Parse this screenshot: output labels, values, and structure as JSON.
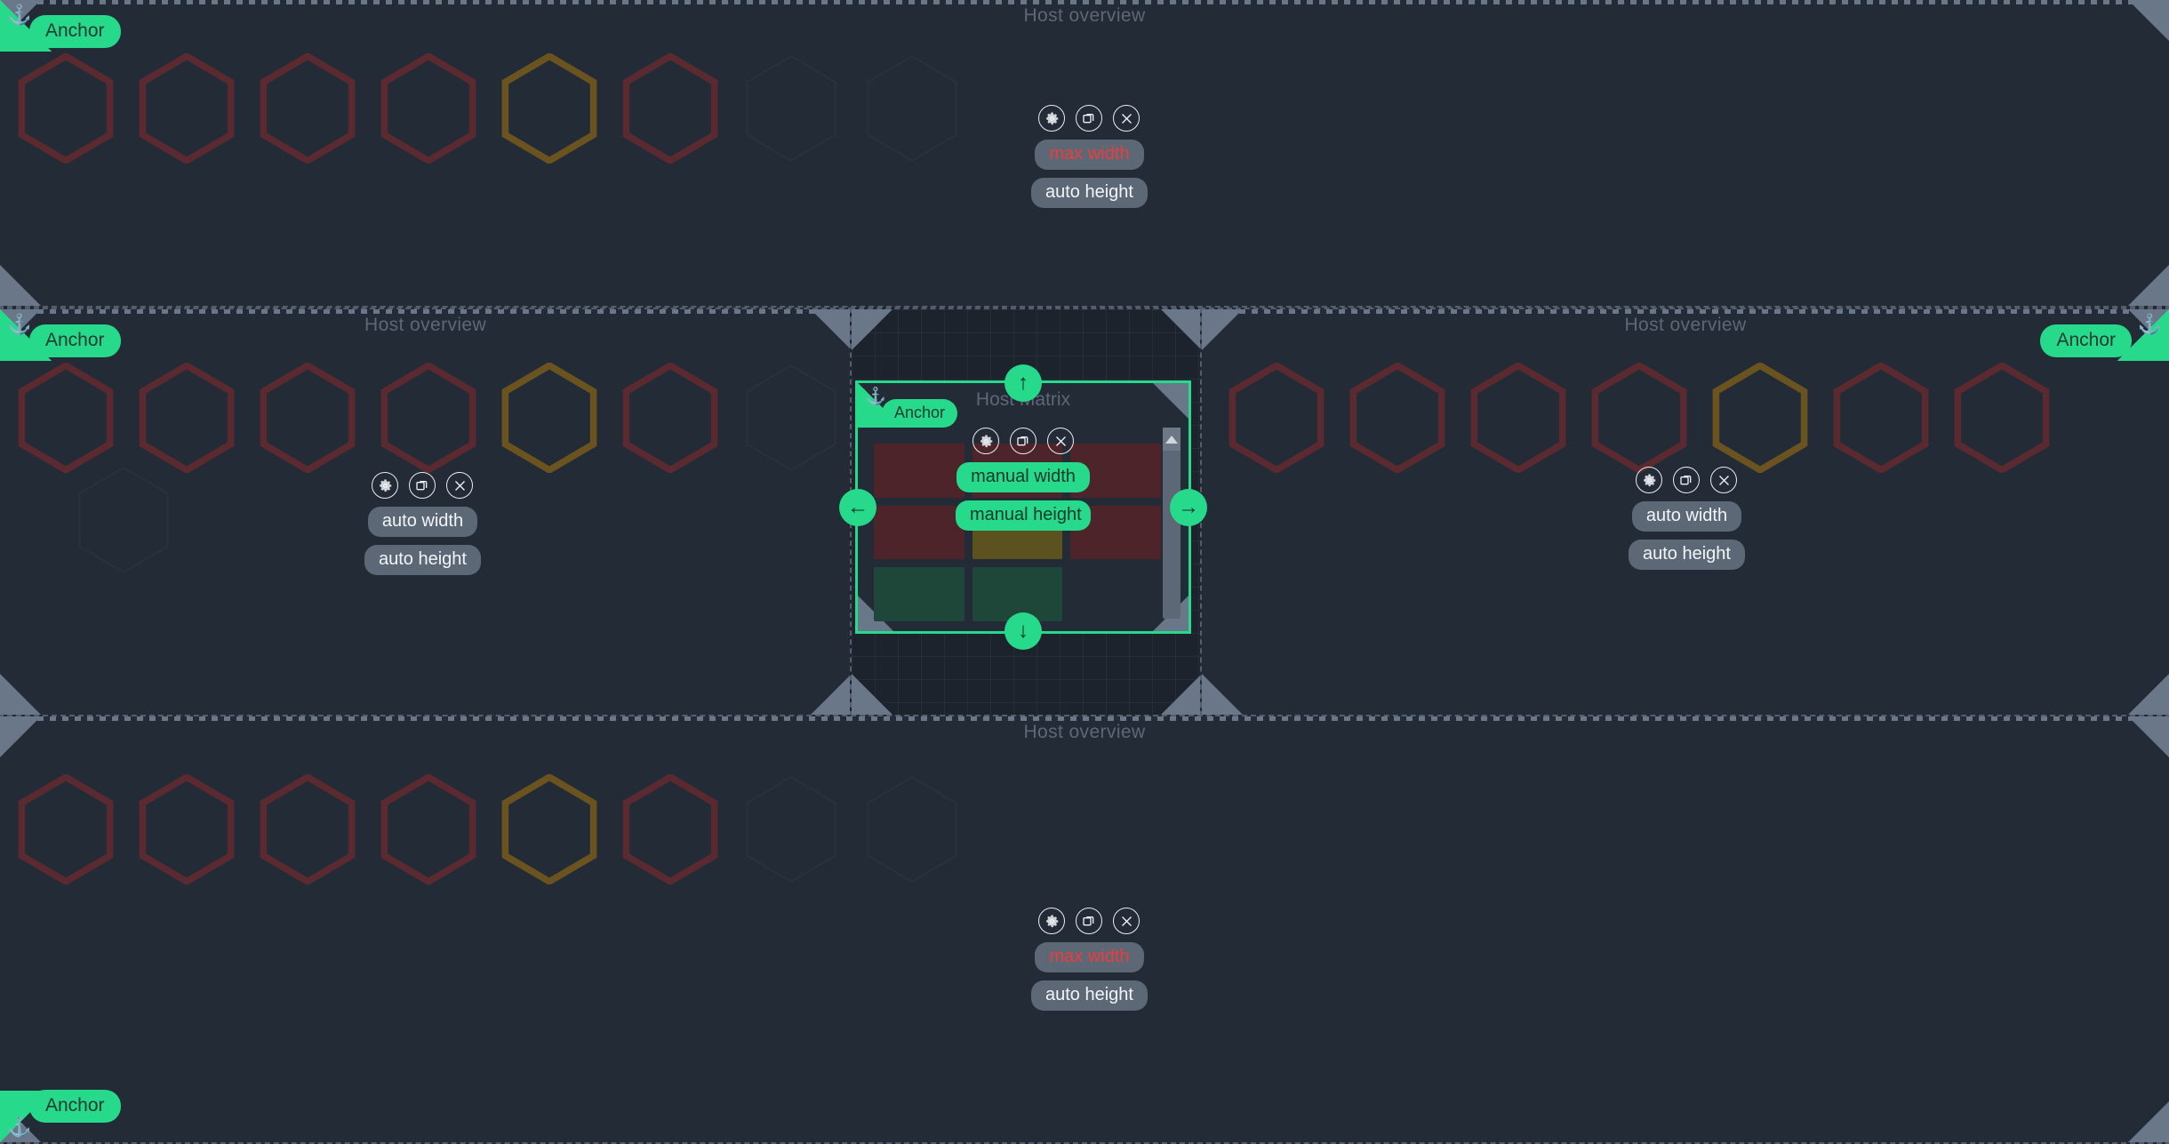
{
  "theme": {
    "bg": "#232b36",
    "grid_bg": "#1d232d",
    "accent_green": "#27d98a",
    "danger_red": "#ef3b3b",
    "pill_grey": "#5c6876",
    "border_dashed": "#545d6b",
    "handle_grey": "#6a7789",
    "hex_red": "#5b2a30",
    "hex_gold": "#6b5320",
    "hex_faint": "#29313c",
    "tile_red": "#4c2429",
    "tile_green": "#1e4739",
    "tile_olive": "#5c5220",
    "title_grey": "#5d6775"
  },
  "icons": {
    "anchor": "anchor-icon",
    "gear": "gear-icon",
    "duplicate": "duplicate-icon",
    "close": "close-icon",
    "arrow_up": "↑",
    "arrow_down": "↓",
    "arrow_left": "←",
    "arrow_right": "→"
  },
  "anchor_label": "Anchor",
  "regions": [
    {
      "id": "top",
      "title": "Host overview",
      "controls": {
        "width_label": "max width",
        "width_state": "danger",
        "height_label": "auto height",
        "height_state": "normal"
      },
      "hexagons": [
        {
          "state": "active"
        },
        {
          "state": "active"
        },
        {
          "state": "active"
        },
        {
          "state": "active"
        },
        {
          "state": "selected"
        },
        {
          "state": "active"
        },
        {
          "state": "faint"
        },
        {
          "state": "faint"
        }
      ]
    },
    {
      "id": "middle-left",
      "title": "Host overview",
      "controls": {
        "width_label": "auto width",
        "width_state": "normal",
        "height_label": "auto height",
        "height_state": "normal"
      },
      "hexagons": [
        {
          "state": "active"
        },
        {
          "state": "active"
        },
        {
          "state": "active"
        },
        {
          "state": "active"
        },
        {
          "state": "selected"
        },
        {
          "state": "active"
        },
        {
          "state": "faint"
        }
      ],
      "extra_faint_hexagon": true
    },
    {
      "id": "middle-right",
      "title": "Host overview",
      "controls": {
        "width_label": "auto width",
        "width_state": "normal",
        "height_label": "auto height",
        "height_state": "normal"
      },
      "hexagons": [
        {
          "state": "active"
        },
        {
          "state": "active"
        },
        {
          "state": "active"
        },
        {
          "state": "active"
        },
        {
          "state": "selected"
        },
        {
          "state": "active"
        },
        {
          "state": "active"
        }
      ]
    },
    {
      "id": "bottom",
      "title": "Host overview",
      "controls": {
        "width_label": "max width",
        "width_state": "danger",
        "height_label": "auto height",
        "height_state": "normal"
      },
      "hexagons": [
        {
          "state": "active"
        },
        {
          "state": "active"
        },
        {
          "state": "active"
        },
        {
          "state": "active"
        },
        {
          "state": "selected"
        },
        {
          "state": "active"
        },
        {
          "state": "faint"
        },
        {
          "state": "faint"
        }
      ]
    }
  ],
  "matrix": {
    "title": "Host Matrix",
    "anchor_label": "Anchor",
    "controls": {
      "width_label": "manual width",
      "width_state": "green",
      "height_label": "manual height",
      "height_state": "green"
    },
    "grid": {
      "rows": 3,
      "cols": 3,
      "cells": [
        [
          "red",
          "red",
          "red"
        ],
        [
          "red",
          "olive",
          "red"
        ],
        [
          "green",
          "green",
          "empty"
        ]
      ]
    },
    "scrollbar": {
      "orientation": "vertical",
      "has_up_button": true
    },
    "nav_arrows": [
      "↑",
      "↓",
      "←",
      "→"
    ]
  }
}
